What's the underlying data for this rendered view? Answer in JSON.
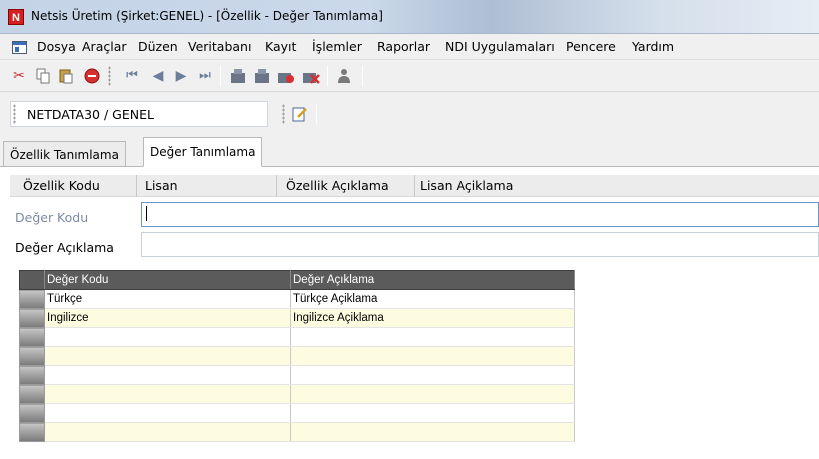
{
  "window": {
    "app_logo": "N",
    "title": "Netsis Üretim (Şirket:GENEL) - [Özellik - Değer Tanımlama]"
  },
  "menu": {
    "items": [
      {
        "label": "Dosya"
      },
      {
        "label": "Araçlar"
      },
      {
        "label": "Düzen"
      },
      {
        "label": "Veritabanı"
      },
      {
        "label": "Kayıt"
      },
      {
        "label": "İşlemler"
      },
      {
        "label": "Raporlar"
      },
      {
        "label": "NDI Uygulamaları"
      },
      {
        "label": "Pencere"
      },
      {
        "label": "Yardım"
      }
    ]
  },
  "toolbar": {
    "icons": [
      "cut-icon",
      "copy-icon",
      "paste-icon",
      "cancel-icon",
      "first-record-icon",
      "prev-record-icon",
      "next-record-icon",
      "last-record-icon",
      "save-icon",
      "save-as-icon",
      "export-icon",
      "delete-icon",
      "user-icon"
    ]
  },
  "path": {
    "label": "NETDATA30 / GENEL"
  },
  "tabs": [
    {
      "label": "Özellik Tanımlama",
      "active": false
    },
    {
      "label": "Değer Tanımlama",
      "active": true
    }
  ],
  "header_columns": [
    "Özellik Kodu",
    "Lisan",
    "Özellik Açıklama",
    "Lisan Açiklama"
  ],
  "form": {
    "deger_kodu_label": "Değer Kodu",
    "deger_kodu_value": "",
    "deger_aciklama_label": "Değer Açıklama",
    "deger_aciklama_value": ""
  },
  "grid": {
    "columns": [
      "Değer Kodu",
      "Değer Açıklama"
    ],
    "rows": [
      {
        "kod": "Türkçe",
        "aciklama": "Türkçe Açiklama"
      },
      {
        "kod": "Ingilizce",
        "aciklama": "Ingilizce Açiklama"
      },
      {
        "kod": "",
        "aciklama": ""
      },
      {
        "kod": "",
        "aciklama": ""
      },
      {
        "kod": "",
        "aciklama": ""
      },
      {
        "kod": "",
        "aciklama": ""
      },
      {
        "kod": "",
        "aciklama": ""
      },
      {
        "kod": "",
        "aciklama": ""
      },
      {
        "kod": "",
        "aciklama": ""
      }
    ]
  },
  "colors": {
    "row_even": "#fdfbe0",
    "grid_header": "#5b5b5b",
    "accent_red": "#d42020"
  }
}
